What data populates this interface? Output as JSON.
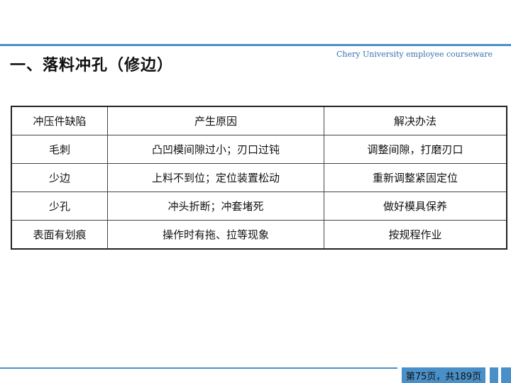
{
  "slide": {
    "title": "一、落料冲孔（修边）",
    "watermark": "Chery University employee courseware",
    "page_indicator": "第75页，共189页"
  },
  "table": {
    "headers": [
      "冲压件缺陷",
      "产生原因",
      "解决办法"
    ],
    "rows": [
      [
        "毛刺",
        "凸凹模间隙过小；刃口过钝",
        "调整间隙，打磨刃口"
      ],
      [
        "少边",
        "上料不到位；定位装置松动",
        "重新调整紧固定位"
      ],
      [
        "少孔",
        "冲头折断；冲套堵死",
        "做好模具保养"
      ],
      [
        "表面有划痕",
        "操作时有拖、拉等现象",
        "按规程作业"
      ]
    ]
  },
  "colors": {
    "accent": "#4a90c8",
    "watermark": "#3a6fb0"
  }
}
